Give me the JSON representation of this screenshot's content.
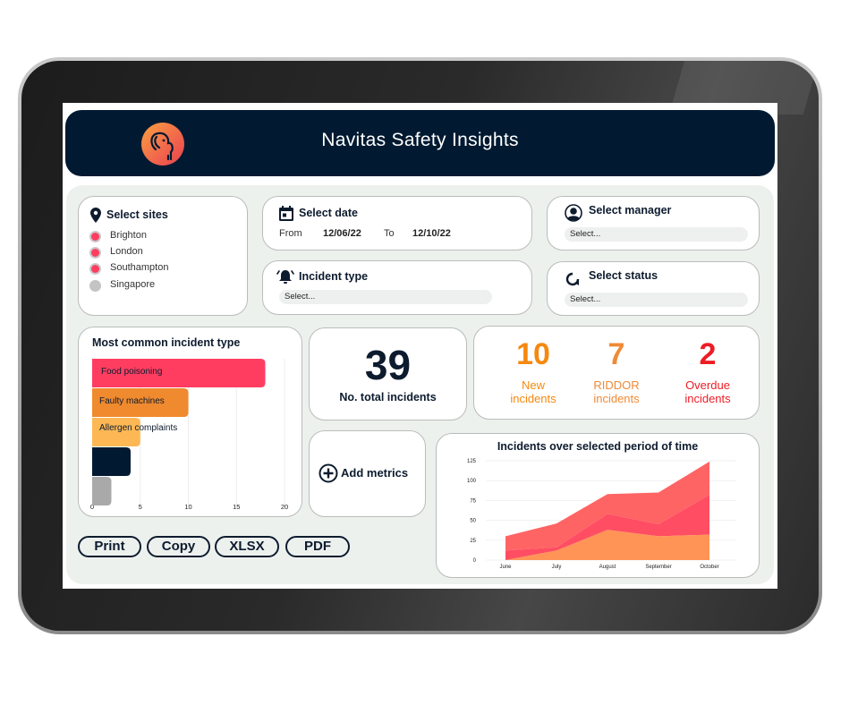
{
  "app": {
    "title": "Navitas Safety Insights",
    "logo_icon": "elephant-logo-icon"
  },
  "filters": {
    "sites": {
      "title": "Select sites",
      "icon": "map-pin-icon",
      "items": [
        {
          "label": "Brighton",
          "selected": true
        },
        {
          "label": "London",
          "selected": true
        },
        {
          "label": "Southampton",
          "selected": true
        },
        {
          "label": "Singapore",
          "selected": false
        }
      ]
    },
    "date": {
      "title": "Select date",
      "icon": "calendar-icon",
      "from_label": "From",
      "from_value": "12/06/22",
      "to_label": "To",
      "to_value": "12/10/22"
    },
    "incident_type": {
      "title": "Incident type",
      "icon": "alarm-bell-icon",
      "placeholder": "Select..."
    },
    "manager": {
      "title": "Select manager",
      "icon": "user-avatar-icon",
      "placeholder": "Select..."
    },
    "status": {
      "title": "Select status",
      "icon": "refresh-icon",
      "placeholder": "Select..."
    }
  },
  "stats": {
    "total": {
      "value": "39",
      "label": "No. total incidents"
    },
    "new": {
      "value": "10",
      "label_line1": "New",
      "label_line2": "incidents",
      "color": "#f5890f"
    },
    "riddor": {
      "value": "7",
      "label_line1": "RIDDOR",
      "label_line2": "incidents",
      "color": "#f08a36"
    },
    "overdue": {
      "value": "2",
      "label_line1": "Overdue",
      "label_line2": "incidents",
      "color": "#ee1c25"
    }
  },
  "add_metrics": {
    "label": "Add metrics",
    "icon": "plus-circle-icon"
  },
  "export_buttons": [
    "Print",
    "Copy",
    "XLSX",
    "PDF"
  ],
  "colors": {
    "header_bg": "#011a31",
    "panel_bg": "#edf1ee",
    "site_selected": "#ff3d61",
    "site_unselected": "#c4c4c4"
  },
  "chart_data": [
    {
      "type": "bar",
      "orientation": "horizontal",
      "title": "Most common incident type",
      "categories": [
        "Food poisoning",
        "Faulty machines",
        "Allergen complaints",
        "",
        ""
      ],
      "values": [
        18,
        10,
        5,
        4,
        2
      ],
      "colors": [
        "#ff3d61",
        "#f08a2e",
        "#fdb855",
        "#011a31",
        "#a9a9a9"
      ],
      "xticks": [
        "0",
        "5",
        "10",
        "15",
        "20"
      ],
      "xlim": [
        0,
        20
      ],
      "grid": true
    },
    {
      "type": "area",
      "stacked": true,
      "title": "Incidents over selected period of time",
      "categories": [
        "June",
        "July",
        "August",
        "September",
        "October"
      ],
      "series": [
        {
          "name": "layer-1",
          "values": [
            0,
            12,
            38,
            30,
            32
          ],
          "color": "#ff9456"
        },
        {
          "name": "layer-2",
          "values": [
            12,
            4,
            20,
            15,
            50
          ],
          "color": "#ff4d63"
        },
        {
          "name": "layer-3",
          "values": [
            18,
            30,
            25,
            40,
            42
          ],
          "color": "#ff6464"
        }
      ],
      "yticks": [
        "0",
        "25",
        "50",
        "75",
        "100",
        "125"
      ],
      "ylim": [
        0,
        125
      ],
      "grid": true
    }
  ]
}
